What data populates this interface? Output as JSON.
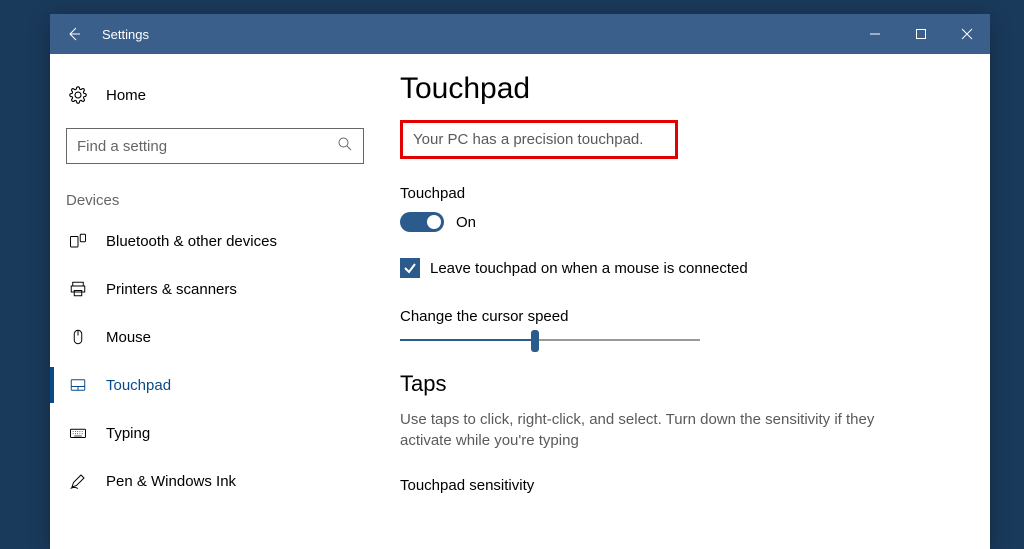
{
  "titlebar": {
    "title": "Settings"
  },
  "sidebar": {
    "home": "Home",
    "search_placeholder": "Find a setting",
    "section": "Devices",
    "items": [
      {
        "label": "Bluetooth & other devices"
      },
      {
        "label": "Printers & scanners"
      },
      {
        "label": "Mouse"
      },
      {
        "label": "Touchpad"
      },
      {
        "label": "Typing"
      },
      {
        "label": "Pen & Windows Ink"
      }
    ]
  },
  "content": {
    "page_title": "Touchpad",
    "precision_note": "Your PC has a precision touchpad.",
    "touchpad_label": "Touchpad",
    "toggle_state": "On",
    "leave_on_label": "Leave touchpad on when a mouse is connected",
    "cursor_speed_label": "Change the cursor speed",
    "taps_title": "Taps",
    "taps_desc": "Use taps to click, right-click, and select. Turn down the sensitivity if they activate while you're typing",
    "sensitivity_label": "Touchpad sensitivity"
  }
}
